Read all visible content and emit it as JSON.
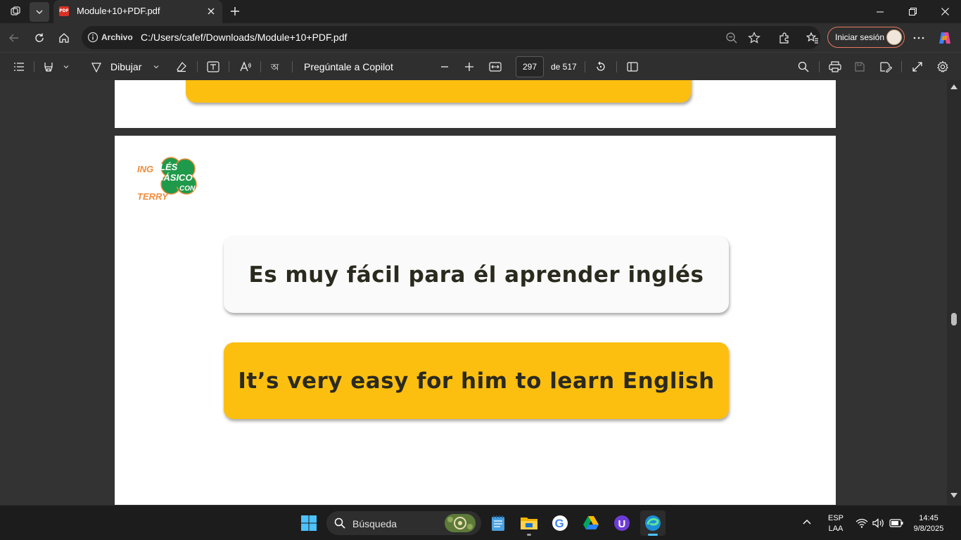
{
  "browser": {
    "tab_title": "Module+10+PDF.pdf",
    "tab_favicon_text": "PDF",
    "address_scheme": "Archivo",
    "address_url": "C:/Users/cafef/Downloads/Module+10+PDF.pdf",
    "signin_label": "Iniciar sesión"
  },
  "pdf_toolbar": {
    "draw_label": "Dibujar",
    "copilot_label": "Pregúntale a Copilot",
    "current_page": "297",
    "page_count": "de 517"
  },
  "document": {
    "logo_text_top": "ING",
    "logo_text_bottom": "TERRY",
    "logo_badge_line1": "LÉS",
    "logo_badge_line2": "BÁSICO",
    "logo_badge_line3": "CON",
    "spanish_sentence": "Es muy fácil para él aprender inglés",
    "english_sentence": "It’s very easy for him to learn English",
    "card_white_color": "#fafafa",
    "card_yellow_color": "#fdbf0f",
    "logo_green": "#1f9a4a",
    "logo_orange": "#f08c3c"
  },
  "taskbar": {
    "search_label": "Búsqueda",
    "apps": [
      "windows-start-icon",
      "notepad-icon",
      "file-explorer-icon",
      "google-chrome-icon",
      "google-drive-icon",
      "u-app-icon",
      "microsoft-edge-icon"
    ],
    "lang_line1": "ESP",
    "lang_line2": "LAA",
    "time": "14:45",
    "date": "9/8/2025"
  }
}
